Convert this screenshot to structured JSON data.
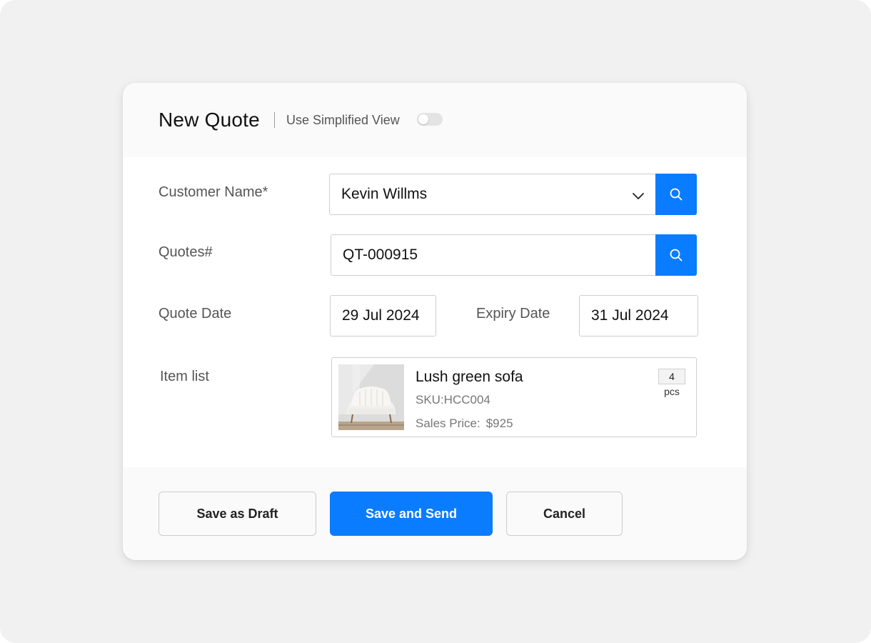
{
  "header": {
    "title": "New Quote",
    "simplified_view_label": "Use Simplified View",
    "simplified_view_enabled": false
  },
  "form": {
    "customer_name": {
      "label": "Customer Name*",
      "value": "Kevin Willms"
    },
    "quote_number": {
      "label": "Quotes#",
      "value": "QT-000915"
    },
    "quote_date": {
      "label": "Quote Date",
      "value": "29 Jul 2024"
    },
    "expiry_date": {
      "label": "Expiry Date",
      "value": "31 Jul 2024"
    },
    "item_list": {
      "label": "Item list",
      "items": [
        {
          "name": "Lush green sofa",
          "sku": "SKU:HCC004",
          "price_label": "Sales Price:",
          "price_value": "$925",
          "quantity": "4",
          "unit": "pcs"
        }
      ]
    }
  },
  "footer": {
    "save_draft_label": "Save as Draft",
    "save_send_label": "Save and Send",
    "cancel_label": "Cancel"
  },
  "icons": {
    "search": "search-icon",
    "dropdown": "chevron-down-icon"
  },
  "colors": {
    "accent": "#0a7cff",
    "page_background": "#f1f1f1",
    "card_background": "#ffffff"
  }
}
